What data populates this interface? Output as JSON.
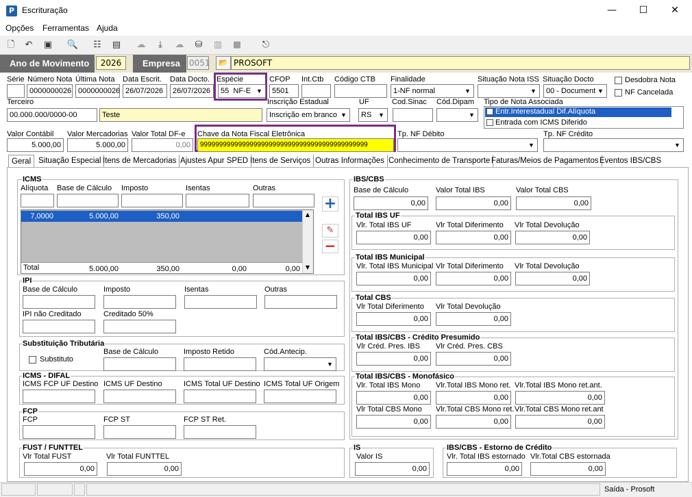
{
  "window": {
    "title": "Escrituração",
    "minimize": "—",
    "maximize": "☐",
    "close": "✕"
  },
  "menu": [
    "Opções",
    "Ferramentas",
    "Ajuda"
  ],
  "header": {
    "ano_label": "Ano de Movimento",
    "ano_value": "2026",
    "empresa_label": "Empresa",
    "empresa_code": "0051",
    "empresa_name": "PROSOFT"
  },
  "doc": {
    "serie_label": "Série",
    "serie": "",
    "numero_label": "Número Nota",
    "numero": "0000000026",
    "ultima_label": "Última Nota",
    "ultima": "0000000026",
    "data_escrit_label": "Data Escrit.",
    "data_escrit": "26/07/2026",
    "data_docto_label": "Data Docto.",
    "data_docto": "26/07/2026",
    "especie_label": "Espécie",
    "especie_code": "55",
    "especie": "NF-E",
    "cfop_label": "CFOP",
    "cfop": "5501",
    "intctb_label": "Int.Ctb",
    "intctb": "",
    "codctb_label": "Código CTB",
    "codctb": "",
    "finalidade_label": "Finalidade",
    "finalidade": "1-NF normal",
    "sit_iss_label": "Situação Nota ISS",
    "sit_iss": "",
    "sit_docto_label": "Situação Docto",
    "sit_docto": "00 - Document",
    "desdobra_label": "Desdobra Nota",
    "cancelada_label": "NF Cancelada",
    "terceiro_label": "Terceiro",
    "terceiro_cnpj": "00.000.000/0000-00",
    "terceiro_nome": "Teste",
    "ie_label": "Inscrição Estadual",
    "ie": "Inscrição em branco",
    "uf_label": "UF",
    "uf": "RS",
    "codsinac_label": "Cod.Sinac",
    "codsinac": "",
    "coddipam_label": "Cód.Dipam",
    "coddipam": "",
    "tipo_assoc_label": "Tipo de Nota Associada",
    "tipo_assoc_opts": [
      "Entr.Interestadual Dif.Alíquota",
      "Entrada com ICMS Diferido"
    ],
    "valor_contabil_label": "Valor Contábil",
    "valor_contabil": "5.000,00",
    "valor_merc_label": "Valor Mercadorias",
    "valor_merc": "5.000,00",
    "valor_dfe_label": "Valor Total DF-e",
    "valor_dfe": "0,00",
    "chave_label": "Chave da Nota Fiscal Eletrônica",
    "chave": "99999999999999999999999999999999999999999999",
    "tp_deb_label": "Tp. NF Débito",
    "tp_deb": "",
    "tp_cred_label": "Tp. NF Crédito",
    "tp_cred": ""
  },
  "tabs": [
    "Geral",
    "Situação Especial",
    "Itens de Mercadorias",
    "Ajustes Apur SPED",
    "Itens de Serviços",
    "Outras Informações",
    "Conhecimento de Transporte",
    "Faturas/Meios de Pagamentos",
    "Eventos IBS/CBS"
  ],
  "icms": {
    "title": "ICMS",
    "cols": [
      "Alíquota",
      "Base de Cálculo",
      "Imposto",
      "Isentas",
      "Outras"
    ],
    "row": [
      "7,0000",
      "5.000,00",
      "350,00",
      "",
      ""
    ],
    "total": [
      "Total",
      "5.000,00",
      "350,00",
      "0,00",
      "0,00"
    ]
  },
  "ipi": {
    "title": "IPI",
    "labels": [
      "Base de Cálculo",
      "Imposto",
      "Isentas",
      "Outras",
      "IPI não Creditado",
      "Creditado 50%"
    ]
  },
  "st": {
    "title": "Substituição Tributária",
    "substituto": "Substituto",
    "labels": [
      "Base de Cálculo",
      "Imposto Retido",
      "Cód.Antecip."
    ]
  },
  "difal": {
    "title": "ICMS - DIFAL",
    "labels": [
      "ICMS FCP UF Destino",
      "ICMS UF Destino",
      "ICMS Total UF Destino",
      "ICMS Total UF Origem"
    ]
  },
  "fcp": {
    "title": "FCP",
    "labels": [
      "FCP",
      "FCP ST",
      "FCP ST Ret."
    ]
  },
  "fust": {
    "title": "FUST / FUNTTEL",
    "l1": "Vlr Total FUST",
    "v1": "0,00",
    "l2": "Vlr Total FUNTTEL",
    "v2": "0,00"
  },
  "ibscbs": {
    "title": "IBS/CBS",
    "labels": [
      "Base de Cálculo",
      "Valor Total IBS",
      "Valor Total CBS"
    ],
    "values": [
      "0,00",
      "0,00",
      "0,00"
    ]
  },
  "ibsuf": {
    "title": "Total IBS UF",
    "labels": [
      "Vlr. Total IBS UF",
      "Vlr Total Diferimento",
      "Vlr Total Devolução"
    ],
    "values": [
      "0,00",
      "0,00",
      "0,00"
    ]
  },
  "ibsmun": {
    "title": "Total IBS Municipal",
    "labels": [
      "Vlr. Total IBS Municipal",
      "Vlr Total Diferimento",
      "Vlr Total Devolução"
    ],
    "values": [
      "0,00",
      "0,00",
      "0,00"
    ]
  },
  "cbs": {
    "title": "Total CBS",
    "labels": [
      "Vlr Total Diferimento",
      "Vlr Total Devolução"
    ],
    "values": [
      "0,00",
      "0,00"
    ]
  },
  "presumido": {
    "title": "Total IBS/CBS - Crédito Presumido",
    "labels": [
      "Vlr Créd. Pres. IBS",
      "Vlr Créd. Pres. CBS"
    ],
    "values": [
      "0,00",
      "0,00"
    ]
  },
  "mono": {
    "title": "Total IBS/CBS - Monofásico",
    "labels": [
      "Vlr. Total IBS Mono",
      "Vlr.Total IBS Mono ret.",
      "Vlr.Total IBS Mono ret.ant.",
      "Vlr Total CBS Mono",
      "Vlr.Total CBS Mono ret.",
      "Vlr.Total CBS Mono ret.ant"
    ],
    "values": [
      "0,00",
      "0,00",
      "0,00",
      "0,00",
      "0,00",
      "0,00"
    ]
  },
  "is": {
    "title": "IS",
    "label": "Valor IS",
    "value": "0,00"
  },
  "estorno": {
    "title": "IBS/CBS - Estorno de Crédito",
    "l1": "Vlr. Total IBS estornado",
    "v1": "0,00",
    "l2": "Vlr.Total CBS estornada",
    "v2": "0,00"
  },
  "status": {
    "text": "Saída - Prosoft"
  }
}
